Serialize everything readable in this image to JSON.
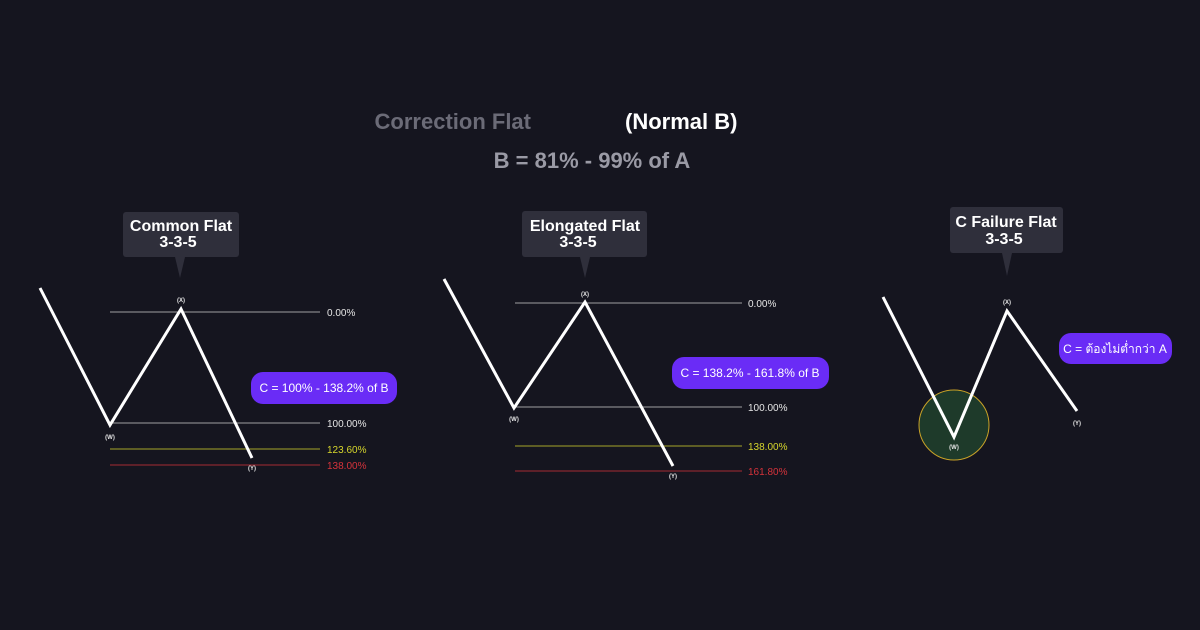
{
  "header": {
    "title_muted": "Correction Flat",
    "title_bold": "(Normal B)",
    "subtitle": "B = 81% - 99% of A"
  },
  "colors": {
    "background": "#15151f",
    "muted_title": "#6b6b77",
    "subtitle": "#9a9aa5",
    "callout_bg": "#2f2f3b",
    "note_bg": "#6a2cf6",
    "level_white": "#cfcfcf",
    "level_yellow": "#d6d62c",
    "level_red": "#d6333b",
    "wave": "#ffffff",
    "failure_circle_fill": "#1e3a2a",
    "failure_circle_stroke": "#c9a227"
  },
  "panels": [
    {
      "name": "common-flat",
      "title_line1": "Common Flat",
      "title_line2": "3-3-5",
      "note": "C = 100% - 138.2% of B",
      "levels": [
        {
          "label": "0.00%",
          "color": "white"
        },
        {
          "label": "100.00%",
          "color": "white"
        },
        {
          "label": "123.60%",
          "color": "yellow"
        },
        {
          "label": "138.00%",
          "color": "red"
        }
      ],
      "wave_labels": [
        "(W)",
        "(X)",
        "(Y)"
      ]
    },
    {
      "name": "elongated-flat",
      "title_line1": "Elongated Flat",
      "title_line2": "3-3-5",
      "note": "C = 138.2% - 161.8% of B",
      "levels": [
        {
          "label": "0.00%",
          "color": "white"
        },
        {
          "label": "100.00%",
          "color": "white"
        },
        {
          "label": "138.00%",
          "color": "yellow"
        },
        {
          "label": "161.80%",
          "color": "red"
        }
      ],
      "wave_labels": [
        "(W)",
        "(X)",
        "(Y)"
      ]
    },
    {
      "name": "c-failure-flat",
      "title_line1": "C Failure Flat",
      "title_line2": "3-3-5",
      "note": "C = ต้องไม่ต่ำกว่า A",
      "levels": [],
      "wave_labels": [
        "(W)",
        "(X)",
        "(Y)"
      ]
    }
  ]
}
